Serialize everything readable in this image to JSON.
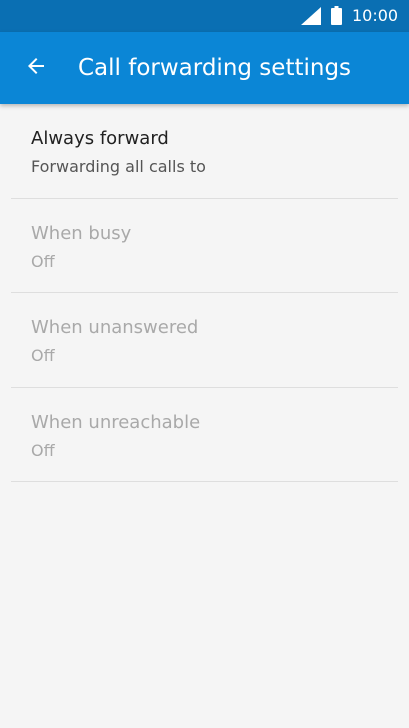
{
  "status_bar": {
    "time": "10:00",
    "icons": [
      "signal-icon",
      "battery-icon"
    ]
  },
  "app_bar": {
    "title": "Call forwarding settings",
    "back_icon": "arrow-left-icon"
  },
  "items": [
    {
      "title": "Always forward",
      "subtitle": "Forwarding all calls to",
      "enabled": true
    },
    {
      "title": "When busy",
      "subtitle": "Off",
      "enabled": false
    },
    {
      "title": "When unanswered",
      "subtitle": "Off",
      "enabled": false
    },
    {
      "title": "When unreachable",
      "subtitle": "Off",
      "enabled": false
    }
  ],
  "colors": {
    "status_bar": "#0a6fb3",
    "app_bar": "#0b86d6",
    "background": "#f5f5f5",
    "enabled_text": "#212121",
    "disabled_text": "#a9a9a9"
  }
}
